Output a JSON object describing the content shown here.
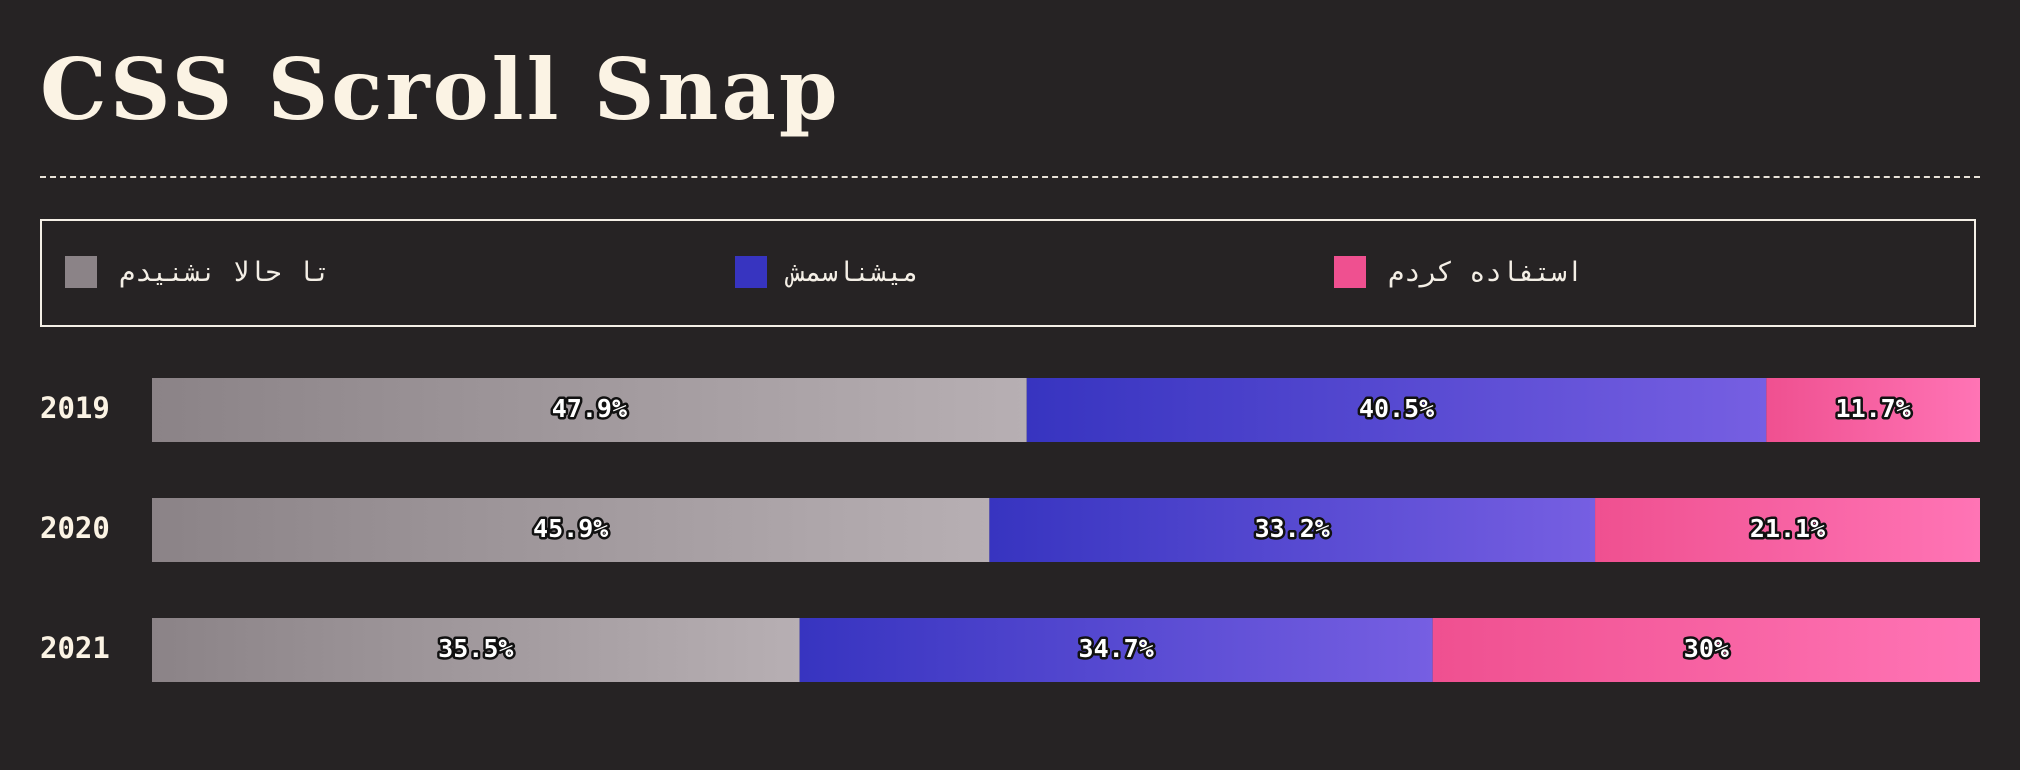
{
  "title": "CSS Scroll Snap",
  "legend": [
    {
      "label": "تا حالا نشنیدم",
      "color": "#8b8387"
    },
    {
      "label": "میشناسمش",
      "color": "#3734c0"
    },
    {
      "label": "استفاده کردم",
      "color": "#ef5090"
    }
  ],
  "chart_data": {
    "type": "bar",
    "orientation": "horizontal",
    "stacked": true,
    "categories": [
      "2019",
      "2020",
      "2021"
    ],
    "series": [
      {
        "name": "تا حالا نشنیدم",
        "values": [
          47.9,
          45.9,
          35.5
        ],
        "labels": [
          "47.9%",
          "45.9%",
          "35.5%"
        ],
        "color_start": "#8b8387",
        "color_end": "#b7afb3"
      },
      {
        "name": "میشناسمش",
        "values": [
          40.5,
          33.2,
          34.7
        ],
        "labels": [
          "40.5%",
          "33.2%",
          "34.7%"
        ],
        "color_start": "#3734c0",
        "color_end": "#765fe2"
      },
      {
        "name": "استفاده کردم",
        "values": [
          11.7,
          21.1,
          30
        ],
        "labels": [
          "11.7%",
          "21.1%",
          "30%"
        ],
        "color_start": "#ef5090",
        "color_end": "#ff74b5"
      }
    ],
    "xlim": [
      0,
      100
    ],
    "grid": false,
    "legend_position": "top"
  }
}
